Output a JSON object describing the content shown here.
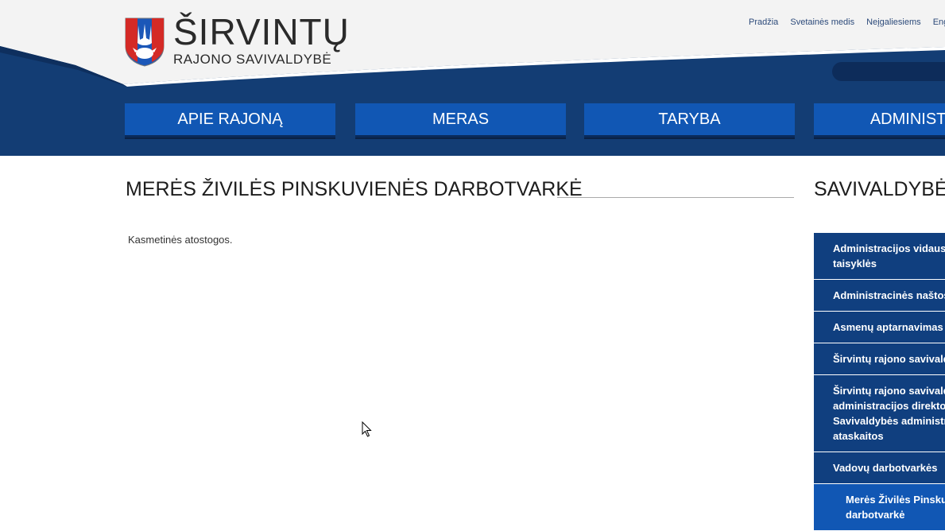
{
  "brand": {
    "title": "ŠIRVINTŲ",
    "subtitle": "RAJONO SAVIVALDYBĖ",
    "logo_icon": "coat-of-arms-icon"
  },
  "toplinks": [
    "Pradžia",
    "Svetainės medis",
    "Neįgaliesiems",
    "Eng"
  ],
  "nav": [
    "APIE RAJONĄ",
    "MERAS",
    "TARYBA",
    "ADMINISTRA"
  ],
  "main": {
    "title": "MERĖS ŽIVILĖS PINSKUVIENĖS DARBOTVARKĖ",
    "text": "Kasmetinės atostogos."
  },
  "sidebar": {
    "title": "SAVIVALDYBĖ",
    "items": [
      {
        "lines": [
          "Administracijos vidaus da",
          "taisyklės"
        ]
      },
      {
        "lines": [
          "Administracinės naštos m"
        ]
      },
      {
        "lines": [
          "Asmenų aptarnavimas"
        ]
      },
      {
        "lines": [
          "Širvintų rajono savivaldyb"
        ]
      },
      {
        "lines": [
          "Širvintų rajono savivaldyb",
          "administracijos direktoria",
          "Savivaldybės administrac",
          "ataskaitos"
        ]
      },
      {
        "lines": [
          "Vadovų darbotvarkės"
        ]
      },
      {
        "lines": [
          "Merės Živilės Pinskuvi",
          "darbotvarkė"
        ],
        "sub": true
      }
    ]
  },
  "colors": {
    "header_blue": "#133d74",
    "nav_blue": "#1157b4",
    "sidebar_blue": "#103f7f"
  }
}
